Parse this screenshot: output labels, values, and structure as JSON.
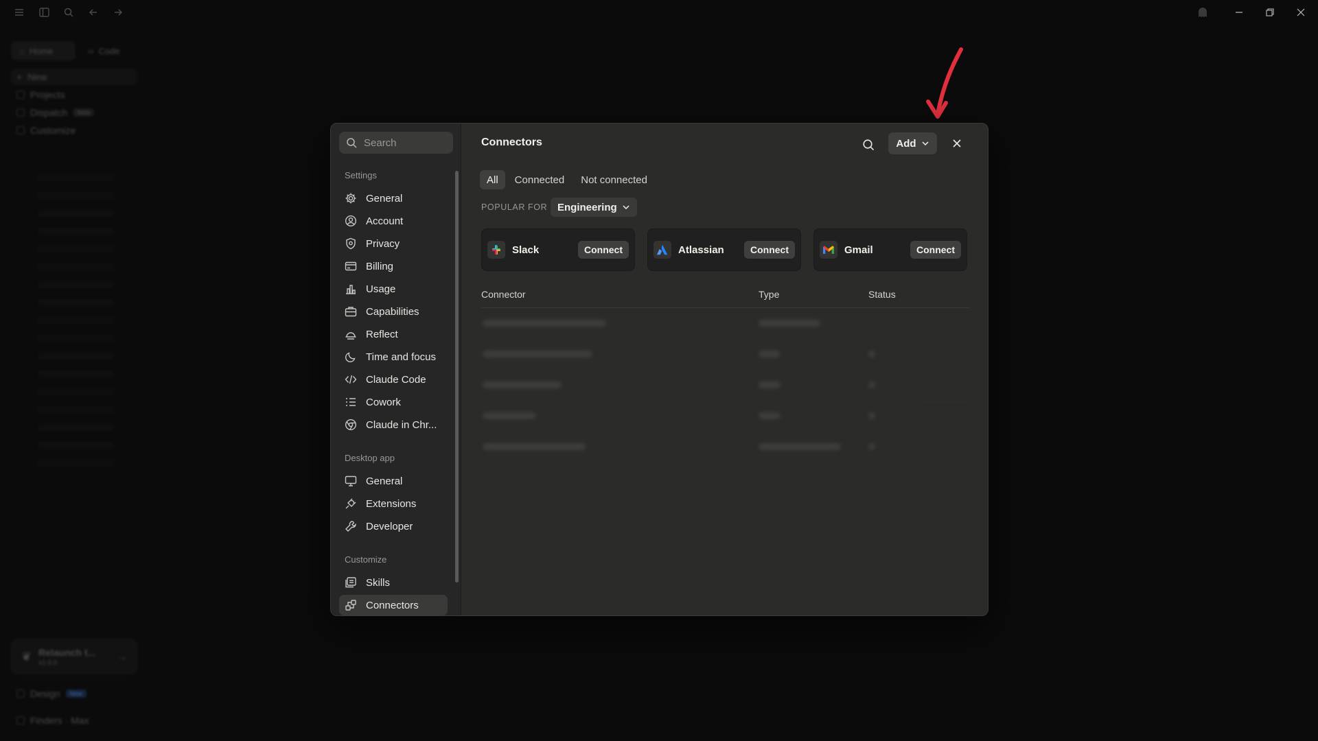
{
  "background": {
    "top_nav": [
      "Home",
      "Code"
    ],
    "items": [
      {
        "label": "New",
        "badge": ""
      },
      {
        "label": "Projects",
        "badge": ""
      },
      {
        "label": "Dispatch",
        "badge": "Beta"
      },
      {
        "label": "Customize",
        "badge": ""
      }
    ],
    "card": {
      "title": "Relaunch t...",
      "subtitle": "v1.0.0"
    },
    "footer_items": [
      {
        "label": "Design",
        "badge": "New"
      },
      {
        "label": "Finders · Max",
        "badge": ""
      }
    ]
  },
  "modal": {
    "search": {
      "placeholder": "Search"
    },
    "sections": [
      {
        "title": "Settings",
        "items": [
          "General",
          "Account",
          "Privacy",
          "Billing",
          "Usage",
          "Capabilities",
          "Reflect",
          "Time and focus",
          "Claude Code",
          "Cowork",
          "Claude in Chr..."
        ]
      },
      {
        "title": "Desktop app",
        "items": [
          "General",
          "Extensions",
          "Developer"
        ]
      },
      {
        "title": "Customize",
        "items": [
          "Skills",
          "Connectors"
        ]
      }
    ],
    "active_item": "Connectors",
    "main": {
      "title": "Connectors",
      "add_label": "Add",
      "tabs": [
        {
          "label": "All",
          "active": true
        },
        {
          "label": "Connected",
          "active": false
        },
        {
          "label": "Not connected",
          "active": false
        }
      ],
      "popular_label": "POPULAR FOR",
      "popular_value": "Engineering",
      "cards": [
        {
          "name": "Slack",
          "button": "Connect",
          "icon": "slack-icon"
        },
        {
          "name": "Atlassian",
          "button": "Connect",
          "icon": "atlassian-icon"
        },
        {
          "name": "Gmail",
          "button": "Connect",
          "icon": "gmail-icon"
        }
      ],
      "table": {
        "columns": [
          "Connector",
          "Type",
          "Status"
        ]
      }
    }
  },
  "colors": {
    "accent_red": "#e0303d",
    "modal_bg": "#2b2b2a",
    "card_bg": "#202020"
  }
}
